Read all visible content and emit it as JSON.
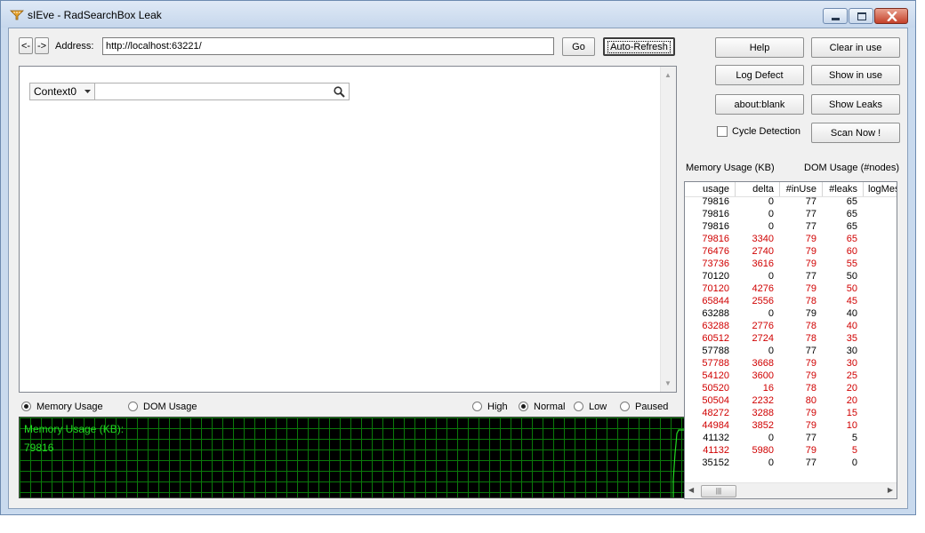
{
  "window": {
    "title": "sIEve - RadSearchBox Leak"
  },
  "toolbar": {
    "back_label": "<-",
    "forward_label": "->",
    "address_label": "Address:",
    "address_value": "http://localhost:63221/",
    "go_label": "Go",
    "autorefresh_label": "Auto-Refresh"
  },
  "page": {
    "context_label": "Context0",
    "search_placeholder": ""
  },
  "side_buttons": {
    "help": "Help",
    "clear_in_use": "Clear in use",
    "log_defect": "Log Defect",
    "show_in_use": "Show in use",
    "about_blank": "about:blank",
    "show_leaks": "Show Leaks",
    "scan_now": "Scan Now !"
  },
  "cycle_detection": {
    "label": "Cycle Detection",
    "checked": false
  },
  "mode": {
    "memory_usage": "Memory Usage",
    "dom_usage": "DOM Usage",
    "selected": "memory"
  },
  "priority": {
    "high": "High",
    "normal": "Normal",
    "low": "Low",
    "paused": "Paused",
    "selected": "normal"
  },
  "graph": {
    "title": "Memory Usage (KB):",
    "value": "79816"
  },
  "stats": {
    "memory_header": "Memory Usage (KB)",
    "dom_header": "DOM Usage (#nodes)",
    "columns": [
      "usage",
      "delta",
      "#inUse",
      "#leaks",
      "logMes"
    ],
    "rows": [
      {
        "usage": "79816",
        "delta": "0",
        "inuse": "77",
        "leaks": "65",
        "red": false
      },
      {
        "usage": "79816",
        "delta": "0",
        "inuse": "77",
        "leaks": "65",
        "red": false
      },
      {
        "usage": "79816",
        "delta": "0",
        "inuse": "77",
        "leaks": "65",
        "red": false
      },
      {
        "usage": "79816",
        "delta": "3340",
        "inuse": "79",
        "leaks": "65",
        "red": true
      },
      {
        "usage": "76476",
        "delta": "2740",
        "inuse": "79",
        "leaks": "60",
        "red": true
      },
      {
        "usage": "73736",
        "delta": "3616",
        "inuse": "79",
        "leaks": "55",
        "red": true
      },
      {
        "usage": "70120",
        "delta": "0",
        "inuse": "77",
        "leaks": "50",
        "red": false
      },
      {
        "usage": "70120",
        "delta": "4276",
        "inuse": "79",
        "leaks": "50",
        "red": true
      },
      {
        "usage": "65844",
        "delta": "2556",
        "inuse": "78",
        "leaks": "45",
        "red": true
      },
      {
        "usage": "63288",
        "delta": "0",
        "inuse": "79",
        "leaks": "40",
        "red": false
      },
      {
        "usage": "63288",
        "delta": "2776",
        "inuse": "78",
        "leaks": "40",
        "red": true
      },
      {
        "usage": "60512",
        "delta": "2724",
        "inuse": "78",
        "leaks": "35",
        "red": true
      },
      {
        "usage": "57788",
        "delta": "0",
        "inuse": "77",
        "leaks": "30",
        "red": false
      },
      {
        "usage": "57788",
        "delta": "3668",
        "inuse": "79",
        "leaks": "30",
        "red": true
      },
      {
        "usage": "54120",
        "delta": "3600",
        "inuse": "79",
        "leaks": "25",
        "red": true
      },
      {
        "usage": "50520",
        "delta": "16",
        "inuse": "78",
        "leaks": "20",
        "red": true
      },
      {
        "usage": "50504",
        "delta": "2232",
        "inuse": "80",
        "leaks": "20",
        "red": true
      },
      {
        "usage": "48272",
        "delta": "3288",
        "inuse": "79",
        "leaks": "15",
        "red": true
      },
      {
        "usage": "44984",
        "delta": "3852",
        "inuse": "79",
        "leaks": "10",
        "red": true
      },
      {
        "usage": "41132",
        "delta": "0",
        "inuse": "77",
        "leaks": "5",
        "red": false
      },
      {
        "usage": "41132",
        "delta": "5980",
        "inuse": "79",
        "leaks": "5",
        "red": true
      },
      {
        "usage": "35152",
        "delta": "0",
        "inuse": "77",
        "leaks": "0",
        "red": false
      }
    ]
  },
  "colors": {
    "red_row": "#d00000",
    "graph_green": "#22dd22",
    "graph_grid": "#0a7a0a"
  }
}
